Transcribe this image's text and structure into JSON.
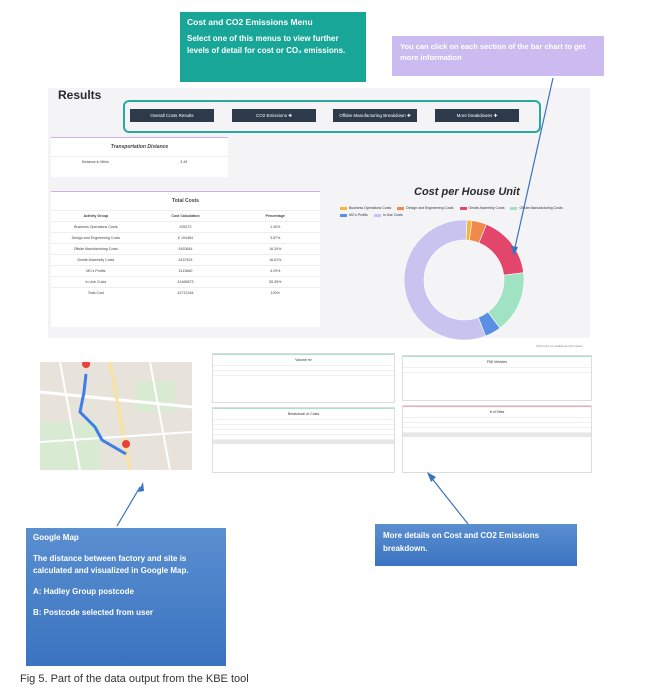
{
  "callouts": {
    "menu_title": "Cost and CO2 Emissions Menu",
    "menu_body": "Select one of this menus to view further levels of detail for cost or CO₂ emissions.",
    "bar_chart": "You can click on each section of the bar chart to get more information",
    "google_map_title": "Google Map",
    "google_map_body": "The distance between factory and site is calculated and visualized in Google Map.",
    "google_map_a": "A: Hadley Group postcode",
    "google_map_b": "B: Postcode selected from user",
    "details": "More details on Cost and CO2 Emissions breakdown."
  },
  "results": {
    "title": "Results",
    "menu_buttons": [
      "Overall Costs Results",
      "CO2 Emissions ✚",
      "Offsite Manufacturing Breakdown ✚",
      "More breakdowns ✚"
    ]
  },
  "transport": {
    "title": "Transportation Distance",
    "label": "Distance in Miles",
    "value": "3.49"
  },
  "total_costs": {
    "title": "Total Costs",
    "headers": [
      "Activity Group",
      "Cost Calculation",
      "Percentage"
    ],
    "rows": [
      [
        "Business Operations Costs",
        "£35272",
        "1.30%"
      ],
      [
        "Design and Engineering Costs",
        "£ 104464",
        "3.87%"
      ],
      [
        "Offsite Manufacturing Costs",
        "£453644",
        "16.34%"
      ],
      [
        "Onsite Assembly Costs",
        "£437624",
        "16.61%"
      ],
      [
        "MC's Profits",
        "£113660",
        "4.29%"
      ],
      [
        "In Use Costs",
        "£1465873",
        "55.35%"
      ],
      [
        "Total Cost",
        "£2712184",
        "100%"
      ]
    ]
  },
  "chart_data": {
    "type": "pie",
    "title": "Cost per House Unit",
    "categories": [
      "Business Operations Costs",
      "Design and Engineering Costs",
      "Onsite Assembly Costs",
      "Offsite Manufacturing Costs",
      "MC's Profits",
      "In Use Costs"
    ],
    "values": [
      1.3,
      3.87,
      16.61,
      16.34,
      4.29,
      55.35
    ],
    "colors": [
      "#f5b43a",
      "#f0894a",
      "#e2466b",
      "#9fe3c2",
      "#5b8fe3",
      "#c9c3f0"
    ]
  },
  "note_right": "Click here for additional information",
  "mini_panels": {
    "volume_title": "Volume m³",
    "breakdown_title": "Breakdown of Costs",
    "fmi_title": "FMI Vehicles",
    "co2_title": "tt of Sites"
  },
  "caption": "Fig 5. Part of the data output from the KBE tool"
}
